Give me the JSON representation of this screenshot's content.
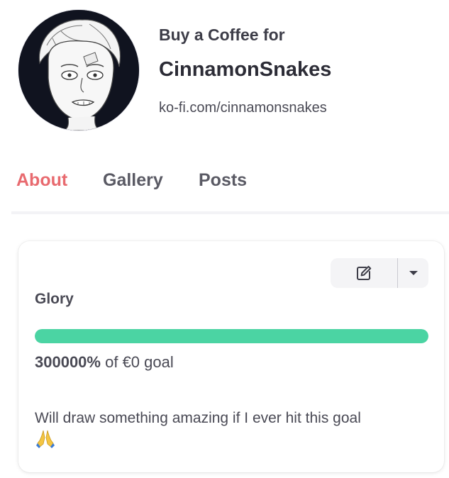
{
  "profile": {
    "kicker": "Buy a Coffee for",
    "name": "CinnamonSnakes",
    "url": "ko-fi.com/cinnamonsnakes"
  },
  "tabs": [
    {
      "label": "About",
      "active": true
    },
    {
      "label": "Gallery",
      "active": false
    },
    {
      "label": "Posts",
      "active": false
    }
  ],
  "goal": {
    "title": "Glory",
    "percent_label": "300000%",
    "of_label": "of €0 goal",
    "progress_fraction": 1.0,
    "description": "Will draw something amazing if I ever hit this goal",
    "description_emoji": "praying-hands-icon",
    "edit_icon": "edit-icon",
    "dropdown_icon": "caret-down-icon"
  },
  "colors": {
    "accent": "#e86a6f",
    "progress": "#4bd4a3",
    "avatar_bg": "#10131f"
  }
}
